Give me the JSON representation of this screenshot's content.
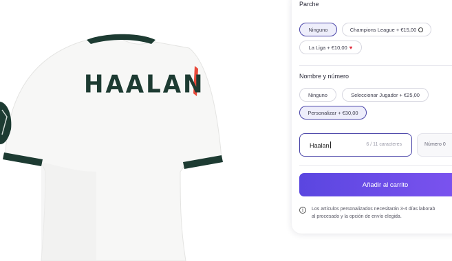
{
  "product": {
    "jersey_name": "HAALAN",
    "colors": {
      "shirt": "#ffffff",
      "trim": "#1d3b32",
      "stripe": "#e8493a"
    }
  },
  "panel": {
    "parche": {
      "label": "Parche",
      "options": [
        {
          "label": "Ninguno",
          "selected": true
        },
        {
          "label": "Champions League + €15,00",
          "icon": "ucl-ball-icon"
        },
        {
          "label": "La Liga + €10,00",
          "icon": "laliga-icon"
        }
      ]
    },
    "nombre": {
      "label": "Nombre y número",
      "options": [
        {
          "label": "Ninguno"
        },
        {
          "label": "Seleccionar Jugador + €25,00"
        },
        {
          "label": "Personalizar + €30,00",
          "selected": true
        }
      ]
    },
    "name_field": {
      "value": "Haalan",
      "counter": "6 / 11 caracteres"
    },
    "number_field": {
      "label": "Número 0"
    },
    "cart_button": {
      "label": "Añadir al carrito",
      "color_from": "#5a46e0",
      "color_to": "#7e54f0"
    },
    "note": {
      "line1": "Los artículos personalizados necesitarán 3-4 días laborab",
      "line2": "al procesado y la opción de envío elegida."
    }
  }
}
